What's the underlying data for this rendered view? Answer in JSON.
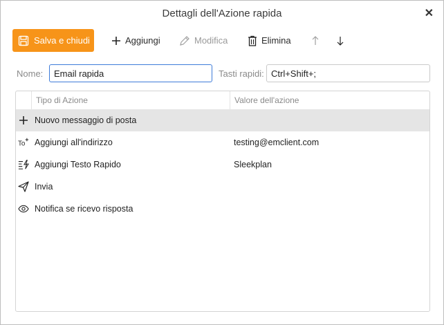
{
  "window": {
    "title": "Dettagli dell'Azione rapida",
    "close_glyph": "✕"
  },
  "toolbar": {
    "save_label": "Salva e chiudi",
    "add_label": "Aggiungi",
    "edit_label": "Modifica",
    "delete_label": "Elimina"
  },
  "form": {
    "name_label": "Nome:",
    "name_value": "Email rapida",
    "hotkey_label": "Tasti rapidi:",
    "hotkey_value": "Ctrl+Shift+;"
  },
  "table": {
    "columns": [
      "Tipo di Azione",
      "Valore dell'azione"
    ],
    "rows": [
      {
        "icon": "plus-icon",
        "type": "Nuovo messaggio di posta",
        "value": "",
        "selected": true
      },
      {
        "icon": "add-recipient-icon",
        "type": "Aggiungi all'indirizzo",
        "value": "testing@emclient.com"
      },
      {
        "icon": "quick-text-icon",
        "type": "Aggiungi Testo Rapido",
        "value": "Sleekplan"
      },
      {
        "icon": "send-icon",
        "type": "Invia",
        "value": ""
      },
      {
        "icon": "eye-icon",
        "type": "Notifica se ricevo risposta",
        "value": ""
      }
    ]
  },
  "colors": {
    "accent": "#f79419",
    "focus": "#3d7bd9",
    "selected_row": "#e5e5e5"
  }
}
